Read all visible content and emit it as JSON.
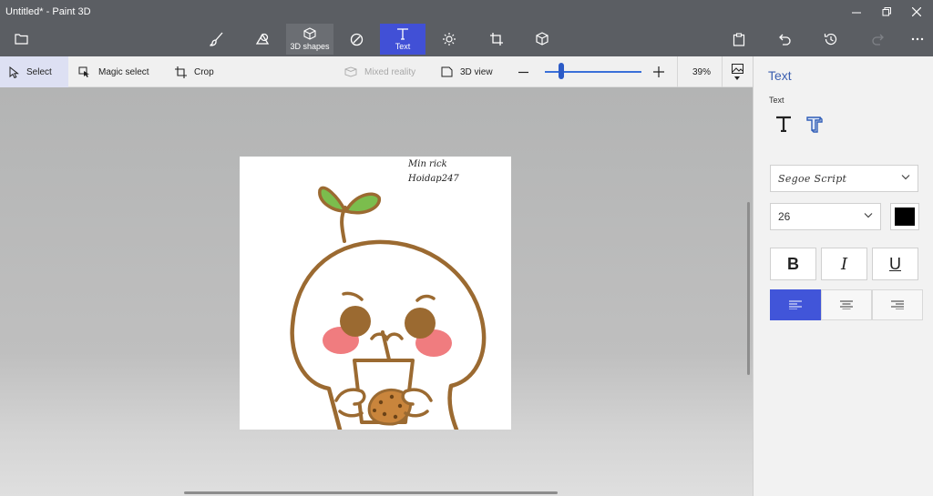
{
  "window": {
    "title": "Untitled* - Paint 3D"
  },
  "toolbar": {
    "shapes3d_label": "3D shapes",
    "text_label": "Text"
  },
  "subtoolbar": {
    "select": "Select",
    "magic_select": "Magic select",
    "crop": "Crop",
    "mixed_reality": "Mixed reality",
    "view3d": "3D view",
    "zoom_percent": "39%",
    "zoom_level": 0.39
  },
  "canvas": {
    "text_line1": "Min rick",
    "text_line2": "Hoidap247"
  },
  "panel": {
    "title": "Text",
    "section": "Text",
    "font": "Segoe Script",
    "size": "26",
    "bold": "B",
    "italic": "I",
    "underline": "U",
    "color": "#000000"
  },
  "colors": {
    "accent": "#4155d9",
    "titlebar": "#5b5e63"
  },
  "icons": [
    "folder-icon",
    "brush-icon",
    "shapes-2d-icon",
    "cube-icon",
    "sticker-icon",
    "text-icon",
    "effects-icon",
    "canvas-icon",
    "library-icon",
    "paste-icon",
    "undo-icon",
    "history-icon",
    "redo-icon",
    "more-icon"
  ]
}
